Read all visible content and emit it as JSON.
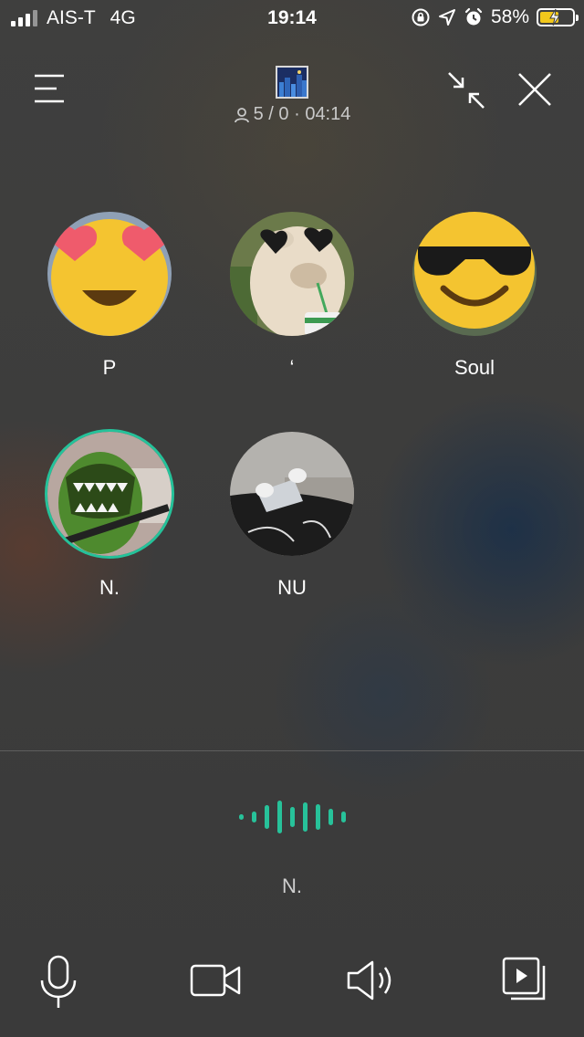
{
  "status_bar": {
    "carrier": "AIS-T",
    "network": "4G",
    "time": "19:14",
    "battery": "58%",
    "battery_level": 0.58,
    "battery_color": "#f2c81c"
  },
  "header": {
    "room_meta": "5 / 0 · 04:14",
    "icons": [
      "menu-icon",
      "shrink-icon",
      "close-icon",
      "person-icon"
    ]
  },
  "participants": [
    {
      "name": "P",
      "avatar": "heart-eyes-emoji",
      "speaking": false
    },
    {
      "name": "‘",
      "avatar": "llama-sunglasses-photo",
      "speaking": false
    },
    {
      "name": "Soul",
      "avatar": "sunglasses-emoji",
      "speaking": false
    },
    {
      "name": "N.",
      "avatar": "dinosaur-toy-photo",
      "speaking": true
    },
    {
      "name": "NU",
      "avatar": "sneakers-photo",
      "speaking": false
    }
  ],
  "active_speaker": {
    "name": "N.",
    "accent_color": "#27c29a"
  },
  "toolbar": {
    "icons": [
      "microphone-icon",
      "video-camera-icon",
      "speaker-icon",
      "screen-share-icon"
    ]
  }
}
